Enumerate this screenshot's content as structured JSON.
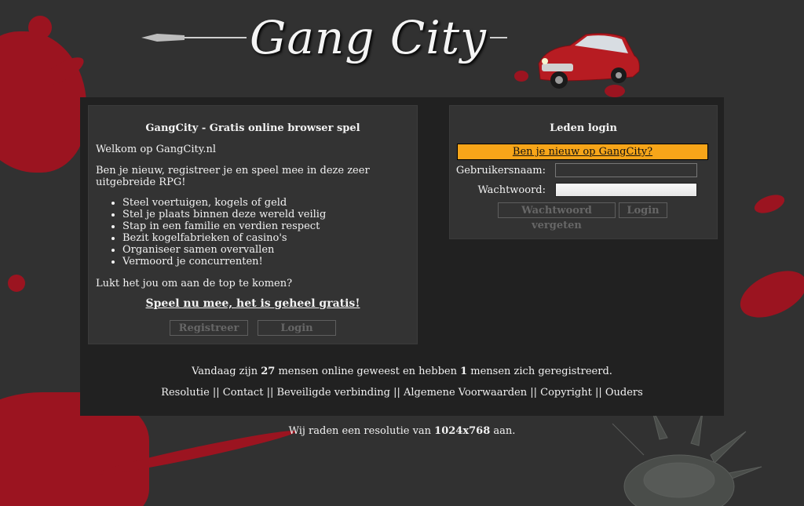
{
  "header": {
    "logo_text": "Gang City"
  },
  "intro_panel": {
    "title": "GangCity - Gratis online browser spel",
    "welcome": "Welkom op GangCity.nl",
    "description": "Ben je nieuw, registreer je en speel mee in deze zeer uitgebreide RPG!",
    "features": [
      "Steel voertuigen, kogels of geld",
      "Stel je plaats binnen deze wereld veilig",
      "Stap in een familie en verdien respect",
      "Bezit kogelfabrieken of casino's",
      "Organiseer samen overvallen",
      "Vermoord je concurrenten!"
    ],
    "question": "Lukt het jou om aan de top te komen?",
    "play_link": "Speel nu mee, het is geheel gratis!",
    "register_button": "Registreer",
    "login_button": "Login"
  },
  "login_panel": {
    "title": "Leden login",
    "new_user_link": "Ben je nieuw op GangCity?",
    "username_label": "Gebruikersnaam:",
    "username_value": "",
    "password_label": "Wachtwoord:",
    "password_value": "",
    "forgot_button": "Wachtwoord vergeten",
    "login_button": "Login"
  },
  "stats": {
    "prefix": "Vandaag zijn ",
    "online_count": "27",
    "middle": " mensen online geweest en hebben ",
    "registered_count": "1",
    "suffix": " mensen zich geregistreerd."
  },
  "footer": {
    "links": [
      "Resolutie",
      "Contact",
      "Beveiligde verbinding",
      "Algemene Voorwaarden",
      "Copyright",
      "Ouders"
    ],
    "separator": " || "
  },
  "resolution_note": {
    "prefix": "Wij raden een resolutie van ",
    "value": "1024x768",
    "suffix": " aan."
  },
  "colors": {
    "background": "#313131",
    "panel": "#333333",
    "accent_orange": "#f7a519",
    "blood_red": "#9b1420"
  }
}
